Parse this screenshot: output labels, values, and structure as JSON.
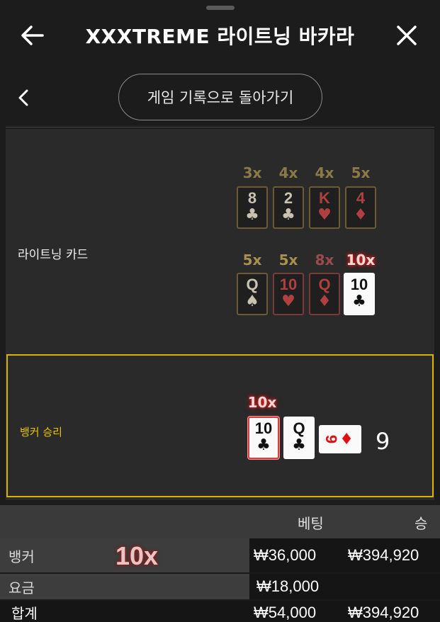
{
  "header": {
    "title": "XXXTREME 라이트닝 바카라",
    "back_icon": "arrow-left-icon",
    "close_icon": "close-icon"
  },
  "subnav": {
    "back_history_label": "게임 기록으로 돌아가기"
  },
  "lightning": {
    "label": "라이트닝 카드",
    "row1": [
      {
        "mult": "3x",
        "rank": "8",
        "suit": "♣"
      },
      {
        "mult": "4x",
        "rank": "2",
        "suit": "♣"
      },
      {
        "mult": "4x",
        "rank": "K",
        "suit": "♥"
      },
      {
        "mult": "5x",
        "rank": "4",
        "suit": "♦"
      }
    ],
    "row2": [
      {
        "mult": "5x",
        "rank": "Q",
        "suit": "♠"
      },
      {
        "mult": "5x",
        "rank": "10",
        "suit": "♥"
      },
      {
        "mult": "8x",
        "rank": "Q",
        "suit": "♦"
      },
      {
        "mult": "10x",
        "rank": "10",
        "suit": "♣"
      }
    ]
  },
  "result": {
    "label": "뱅커 승리",
    "hand_mult": "10x",
    "cards": [
      {
        "rank": "10",
        "suit": "♣"
      },
      {
        "rank": "Q",
        "suit": "♣"
      },
      {
        "rank": "9",
        "suit": "♦"
      }
    ],
    "score": "9"
  },
  "bets": {
    "col_bet": "베팅",
    "col_win": "승",
    "rows": [
      {
        "name": "뱅커",
        "mult": "10x",
        "bet": "₩36,000",
        "win": "₩394,920"
      },
      {
        "name": "요금",
        "bet": "₩18,000"
      },
      {
        "name": "합계",
        "bet": "₩54,000",
        "win": "₩394,920"
      }
    ]
  }
}
